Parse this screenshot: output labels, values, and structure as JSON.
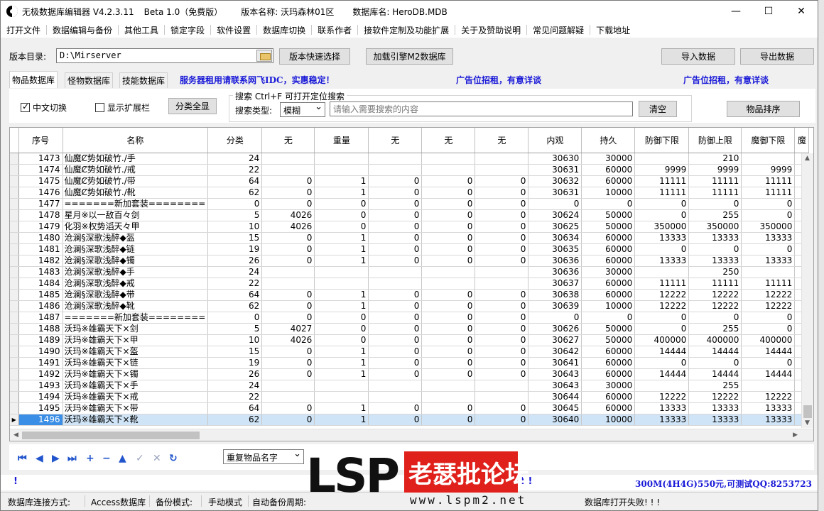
{
  "title": {
    "app": "无极数据库编辑器 V4.2.3.11",
    "beta": "Beta 1.0（免费版）",
    "version_name": "版本名称: 沃玛森林01区",
    "db_name": "数据库名: HeroDB.MDB"
  },
  "window_buttons": {
    "minimize": "—",
    "maximize": "☐",
    "close": "✕"
  },
  "menu": [
    "打开文件",
    "数据编辑与备份",
    "其他工具",
    "锁定字段",
    "软件设置",
    "数据库切换",
    "联系作者",
    "接软件定制及功能扩展",
    "关于及赞助说明",
    "常见问题解疑",
    "下载地址"
  ],
  "version_row": {
    "label": "版本目录:",
    "path": "D:\\Mirserver",
    "quick_select": "版本快速选择",
    "load_engine": "加载引擎M2数据库",
    "import": "导入数据",
    "export": "导出数据"
  },
  "tabs": [
    "物品数据库",
    "怪物数据库",
    "技能数据库"
  ],
  "ads": {
    "server": "服务器租用请联系网飞IDC，实惠稳定！",
    "ad1": "广告位招租，有意详谈",
    "ad2": "广告位招租，有意详谈",
    "bottom": "300M(4H4G)550元,可测试QQ:8253723"
  },
  "controls": {
    "chinese_toggle": "中文切换",
    "show_ext": "显示扩展栏",
    "show_all": "分类全显",
    "search_legend": "搜索  Ctrl+F 可打开定位搜索",
    "search_type_label": "搜索类型:",
    "search_type": "模糊",
    "search_placeholder": "请输入需要搜索的内容",
    "clear": "清空",
    "sort": "物品排序"
  },
  "grid": {
    "columns": [
      "序号",
      "名称",
      "分类",
      "无",
      "重量",
      "无",
      "无",
      "无",
      "内观",
      "持久",
      "防御下限",
      "防御上限",
      "魔御下限",
      "魔"
    ],
    "selected_index": 23,
    "rows": [
      [
        "1473",
        "仙魔Ȼ势如破竹./手",
        "24",
        "",
        "",
        "",
        "",
        "",
        "30630",
        "30000",
        "",
        "210",
        ""
      ],
      [
        "1474",
        "仙魔Ȼ势如破竹./戒",
        "22",
        "",
        "",
        "",
        "",
        "",
        "30631",
        "60000",
        "9999",
        "9999",
        "9999"
      ],
      [
        "1475",
        "仙魔Ȼ势如破竹./带",
        "64",
        "0",
        "1",
        "0",
        "0",
        "0",
        "30632",
        "60000",
        "11111",
        "11111",
        "11111"
      ],
      [
        "1476",
        "仙魔Ȼ势如破竹./靴",
        "62",
        "0",
        "1",
        "0",
        "0",
        "0",
        "30631",
        "10000",
        "11111",
        "11111",
        "11111"
      ],
      [
        "1477",
        "=======新加套装========",
        "0",
        "0",
        "0",
        "0",
        "0",
        "0",
        "0",
        "0",
        "0",
        "0",
        "0"
      ],
      [
        "1478",
        "星月※以一敌百々剑",
        "5",
        "4026",
        "0",
        "0",
        "0",
        "0",
        "30624",
        "50000",
        "0",
        "255",
        "0"
      ],
      [
        "1479",
        "化羽※权势滔天々甲",
        "10",
        "4026",
        "0",
        "0",
        "0",
        "0",
        "30625",
        "50000",
        "350000",
        "350000",
        "350000"
      ],
      [
        "1480",
        "沧澜§深歌浅醉◆盔",
        "15",
        "0",
        "1",
        "0",
        "0",
        "0",
        "30634",
        "60000",
        "13333",
        "13333",
        "13333"
      ],
      [
        "1481",
        "沧澜§深歌浅醉◆链",
        "19",
        "0",
        "1",
        "0",
        "0",
        "0",
        "30635",
        "60000",
        "0",
        "0",
        "0"
      ],
      [
        "1482",
        "沧澜§深歌浅醉◆镯",
        "26",
        "0",
        "1",
        "0",
        "0",
        "0",
        "30636",
        "60000",
        "13333",
        "13333",
        "13333"
      ],
      [
        "1483",
        "沧澜§深歌浅醉◆手",
        "24",
        "",
        "",
        "",
        "",
        "",
        "30636",
        "30000",
        "",
        "250",
        ""
      ],
      [
        "1484",
        "沧澜§深歌浅醉◆戒",
        "22",
        "",
        "",
        "",
        "",
        "",
        "30637",
        "60000",
        "11111",
        "11111",
        "11111"
      ],
      [
        "1485",
        "沧澜§深歌浅醉◆带",
        "64",
        "0",
        "1",
        "0",
        "0",
        "0",
        "30638",
        "60000",
        "12222",
        "12222",
        "12222"
      ],
      [
        "1486",
        "沧澜§深歌浅醉◆靴",
        "62",
        "0",
        "1",
        "0",
        "0",
        "0",
        "30639",
        "10000",
        "12222",
        "12222",
        "12222"
      ],
      [
        "1487",
        "=======新加套装========",
        "0",
        "0",
        "0",
        "0",
        "0",
        "0",
        "0",
        "0",
        "0",
        "0",
        "0"
      ],
      [
        "1488",
        "沃玛※雄霸天下×剑",
        "5",
        "4027",
        "0",
        "0",
        "0",
        "0",
        "30626",
        "50000",
        "0",
        "255",
        "0"
      ],
      [
        "1489",
        "沃玛※雄霸天下×甲",
        "10",
        "4026",
        "0",
        "0",
        "0",
        "0",
        "30627",
        "50000",
        "400000",
        "400000",
        "400000"
      ],
      [
        "1490",
        "沃玛※雄霸天下×盔",
        "15",
        "0",
        "1",
        "0",
        "0",
        "0",
        "30642",
        "60000",
        "14444",
        "14444",
        "14444"
      ],
      [
        "1491",
        "沃玛※雄霸天下×链",
        "19",
        "0",
        "1",
        "0",
        "0",
        "0",
        "30641",
        "60000",
        "0",
        "0",
        "0"
      ],
      [
        "1492",
        "沃玛※雄霸天下×镯",
        "26",
        "0",
        "1",
        "0",
        "0",
        "0",
        "30643",
        "60000",
        "14444",
        "14444",
        "14444"
      ],
      [
        "1493",
        "沃玛※雄霸天下×手",
        "24",
        "",
        "",
        "",
        "",
        "",
        "30643",
        "30000",
        "",
        "255",
        ""
      ],
      [
        "1494",
        "沃玛※雄霸天下×戒",
        "22",
        "",
        "",
        "",
        "",
        "",
        "30644",
        "60000",
        "12222",
        "12222",
        "12222"
      ],
      [
        "1495",
        "沃玛※雄霸天下×带",
        "64",
        "0",
        "1",
        "0",
        "0",
        "0",
        "30645",
        "60000",
        "13333",
        "13333",
        "13333"
      ],
      [
        "1496",
        "沃玛※雄霸天下×靴",
        "62",
        "0",
        "1",
        "0",
        "0",
        "0",
        "30640",
        "10000",
        "13333",
        "13333",
        "13333"
      ]
    ]
  },
  "navigator": {
    "first": "⏮",
    "prev": "◀",
    "next": "▶",
    "last": "⏭",
    "add": "+",
    "delete": "−",
    "edit": "▲",
    "post": "✓",
    "cancel": "✕",
    "refresh": "↻",
    "dup_select": "重复物品名字"
  },
  "info_marks": {
    "left": "!",
    "right": "! !"
  },
  "status": {
    "conn_label": "数据库连接方式:",
    "conn_value": "Access数据库",
    "backup_label": "备份模式:",
    "backup_value": "手动模式",
    "auto_label": "自动备份周期:",
    "db_status": "数据库打开失败! ! !"
  },
  "watermark": {
    "lsp": "LSP",
    "cn": "老瑟批论坛",
    "url": "www.lspm2.net"
  }
}
